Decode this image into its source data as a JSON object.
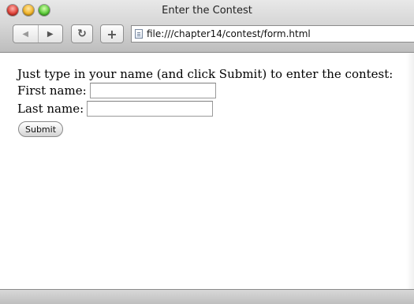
{
  "window": {
    "title": "Enter the Contest"
  },
  "toolbar": {
    "back_icon": "◀",
    "forward_icon": "▶",
    "reload_icon": "↻",
    "add_icon": "+",
    "url": "file:///chapter14/contest/form.html"
  },
  "page": {
    "intro": "Just type in your name (and click Submit) to enter the contest:",
    "first_name_label": "First name:",
    "first_name_value": "",
    "last_name_label": "Last name:",
    "last_name_value": "",
    "submit_label": "Submit"
  },
  "colors": {
    "close": "#e0433a",
    "minimize": "#f2b529",
    "zoom": "#5ccc3a"
  }
}
